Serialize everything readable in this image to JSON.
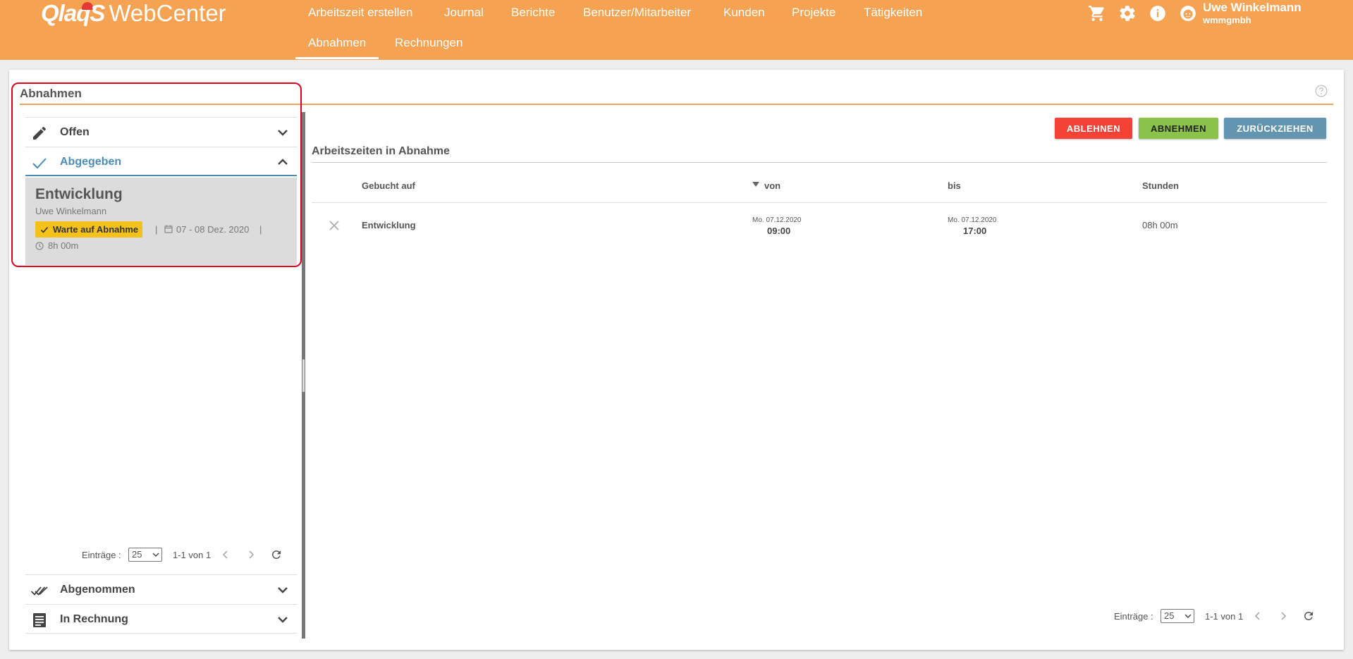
{
  "header": {
    "logo_brand": "QlaqS",
    "logo_product": "WebCenter",
    "nav_row1": [
      "Arbeitszeit erstellen",
      "Journal",
      "Berichte",
      "Benutzer/Mitarbeiter",
      "Kunden",
      "Projekte",
      "Tätigkeiten"
    ],
    "nav_row2": [
      "Abnahmen",
      "Rechnungen"
    ],
    "active_nav": "Abnahmen",
    "user_name": "Uwe Winkelmann",
    "user_company": "wmmgmbh",
    "icons": [
      "cart-icon",
      "gear-icon",
      "info-icon",
      "avatar-icon"
    ]
  },
  "page": {
    "title": "Abnahmen"
  },
  "left_panel": {
    "groups": [
      {
        "label": "Offen",
        "icon": "pencil-icon",
        "expanded": false
      },
      {
        "label": "Abgegeben",
        "icon": "check-icon",
        "expanded": true
      },
      {
        "label": "Abgenommen",
        "icon": "double-check-icon",
        "expanded": false
      },
      {
        "label": "In Rechnung",
        "icon": "receipt-icon",
        "expanded": false
      }
    ],
    "item": {
      "title": "Entwicklung",
      "user": "Uwe Winkelmann",
      "badge": "Warte auf Abnahme",
      "separator": "|",
      "date_range": "07 - 08 Dez. 2020",
      "duration": "8h 00m"
    },
    "pager": {
      "label": "Einträge :",
      "page_size": "25",
      "range": "1-1 von 1"
    }
  },
  "right_panel": {
    "buttons": {
      "reject": "ABLEHNEN",
      "accept": "ABNEHMEN",
      "withdraw": "ZURÜCKZIEHEN"
    },
    "section_title": "Arbeitszeiten in Abnahme",
    "columns": [
      "Gebucht auf",
      "von",
      "bis",
      "Stunden"
    ],
    "rows": [
      {
        "booked_on": "Entwicklung",
        "from_date": "Mo. 07.12.2020",
        "from_time": "09:00",
        "to_date": "Mo. 07.12.2020",
        "to_time": "17:00",
        "hours": "08h 00m"
      }
    ],
    "pager": {
      "label": "Einträge :",
      "page_size": "25",
      "range": "1-1 von 1"
    }
  },
  "colors": {
    "header": "#f5a252",
    "accent_blue": "#4b8db8",
    "reject": "#f44336",
    "accept": "#8bc34a",
    "withdraw": "#6495b0",
    "badge": "#f5c21b"
  }
}
